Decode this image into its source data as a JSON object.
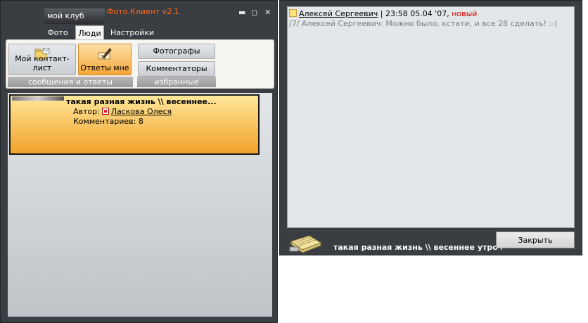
{
  "left_window": {
    "club_label": "мой клуб",
    "app_title": "Фото.Клиент v2.1",
    "window_controls": {
      "minimize": "▬",
      "maximize": "◻",
      "close": "✕"
    },
    "tabs": [
      {
        "label": "Фото"
      },
      {
        "label": "Люди"
      },
      {
        "label": "Настройки"
      }
    ],
    "ribbon": {
      "contact_list": "Мой контакт-лист",
      "replies": "Ответы мне",
      "group_messages": "сообщения и ответы",
      "photographers": "Фотографы",
      "commenters": "Комментаторы",
      "group_favorites": "избранные"
    },
    "item": {
      "title": "такая разная жизнь \\\\ весеннее...",
      "author_label": "Автор:",
      "author_name": "Ласкова Олеся",
      "comments": "Комментариев: 8"
    }
  },
  "right_window": {
    "message": {
      "sender": "Алексей Сергеевич",
      "separator": " | ",
      "datetime": "23:58 05.04 '07, ",
      "status": "новый",
      "body": "/7/ Алексей Сергеевич: Можно было, кстати, и все 28 сделать! :-)"
    },
    "footer_title": "такая разная жизнь \\\\ весеннее утро в гр",
    "close_button": "Закрыть"
  },
  "icons": {
    "contact_list": "contacts-folder-icon",
    "replies": "pen-writing-icon",
    "message": "note-icon",
    "footer": "notepad-icon"
  }
}
